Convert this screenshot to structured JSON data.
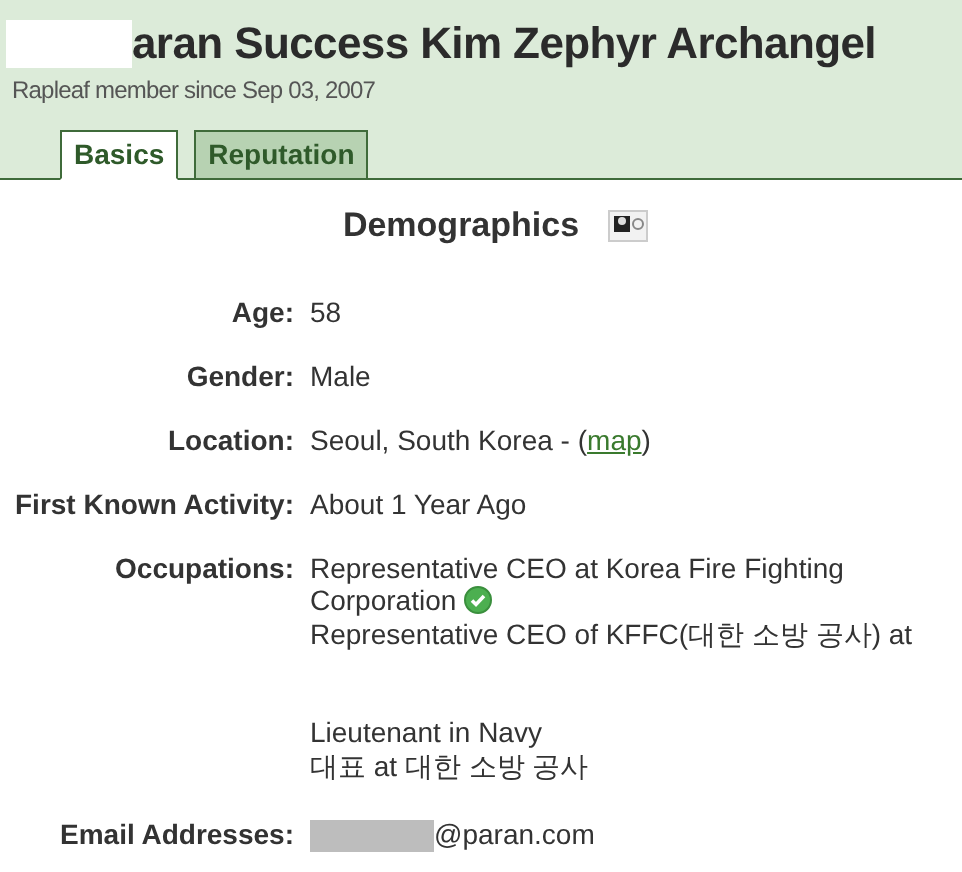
{
  "header": {
    "title": "aran Success Kim Zephyr Archangel",
    "subtitle": "Rapleaf member since Sep 03, 2007"
  },
  "tabs": [
    {
      "label": "Basics",
      "selected": true
    },
    {
      "label": "Reputation",
      "selected": false
    }
  ],
  "section": {
    "title": "Demographics"
  },
  "fields": [
    {
      "kind": "text",
      "label": "Age:",
      "value": "58"
    },
    {
      "kind": "text",
      "label": "Gender:",
      "value": "Male"
    },
    {
      "kind": "location",
      "label": "Location:",
      "value": "Seoul, South Korea - (",
      "link": "map",
      "after": ")"
    },
    {
      "kind": "text",
      "label": "First Known Activity:",
      "value": "About 1 Year Ago"
    },
    {
      "kind": "occupations",
      "label": "Occupations:",
      "items": [
        {
          "lines": [
            "Representative CEO at Korea Fire Fighting Corporation"
          ],
          "verified": true
        },
        {
          "lines": [
            "Representative CEO of KFFC(대한 소방 공사) at",
            "Lieutenant in Navy",
            "대표 at 대한 소방 공사"
          ],
          "verified": false
        }
      ]
    },
    {
      "kind": "email",
      "label": "Email Addresses:",
      "value": "@paran.com"
    }
  ]
}
